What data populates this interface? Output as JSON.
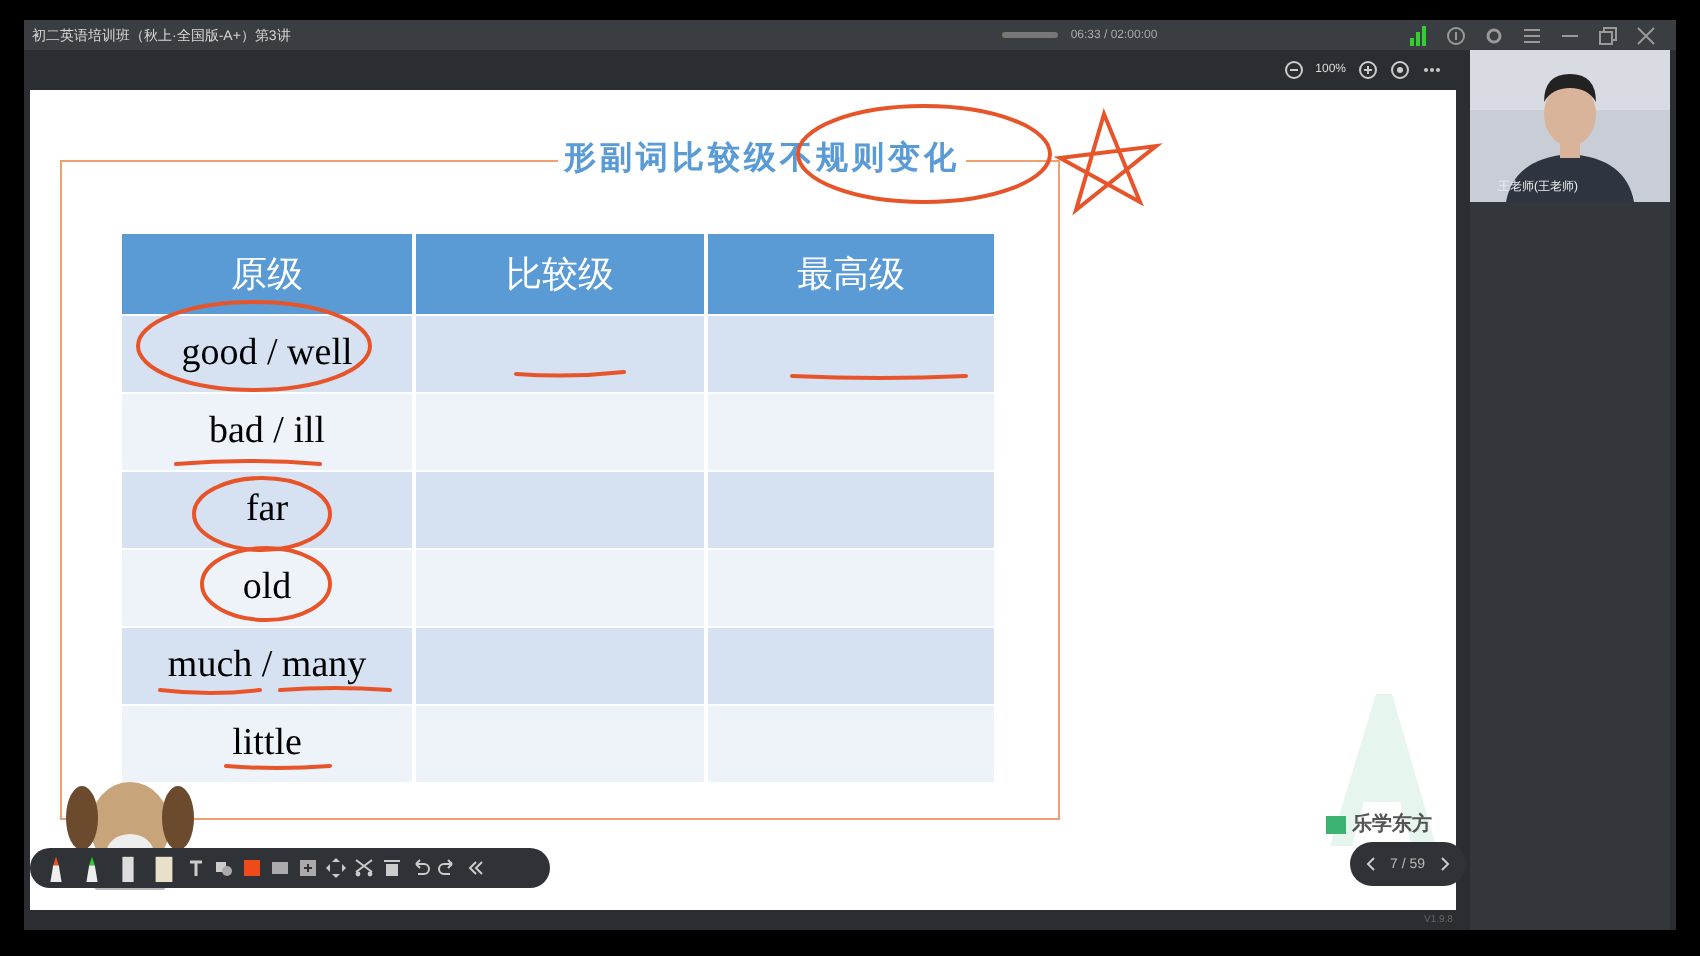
{
  "window": {
    "title": "初二英语培训班（秋上·全国版-A+）第3讲",
    "playback_time": "06:33 / 02:00:00"
  },
  "zoom": {
    "value": "100%"
  },
  "slide": {
    "title": "形副词比较级不规则变化",
    "table": {
      "columns": [
        "原级",
        "比较级",
        "最高级"
      ],
      "rows": [
        {
          "base": "good / well"
        },
        {
          "base": "bad / ill"
        },
        {
          "base": "far"
        },
        {
          "base": "old"
        },
        {
          "base": "much / many"
        },
        {
          "base": "little"
        }
      ]
    },
    "logo_text": "乐学东方"
  },
  "video": {
    "speaker": "王老师(王老师)"
  },
  "page_nav": {
    "page": "7 / 59"
  },
  "version": "V1.9.8"
}
